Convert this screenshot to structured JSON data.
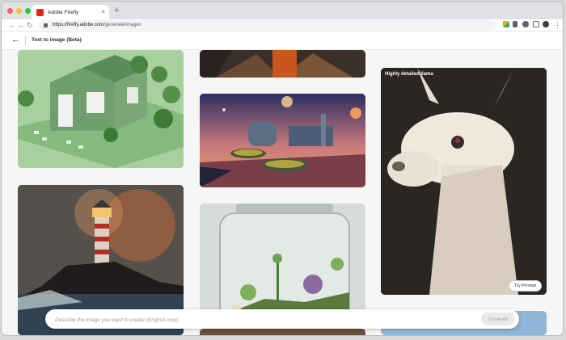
{
  "browser": {
    "tab_title": "Adobe Firefly",
    "new_tab_label": "+",
    "url_host": "https://firefly.adobe.com",
    "url_path": "/generate/images",
    "colors": {
      "close": "#ff5f57",
      "minimize": "#febc2e",
      "maximize": "#28c840",
      "favicon": "#e1251b"
    }
  },
  "app": {
    "title": "Text to image (Beta)"
  },
  "gallery": {
    "cards": [
      {
        "subject": "green cottage",
        "caption": ""
      },
      {
        "subject": "portrait jacket",
        "caption": ""
      },
      {
        "subject": "alien city",
        "caption": ""
      },
      {
        "subject": "lighthouse",
        "caption": ""
      },
      {
        "subject": "terrarium jar",
        "caption": ""
      },
      {
        "subject": "llama",
        "caption": "Highly detailed llama",
        "button": "Try Prompt"
      }
    ]
  },
  "prompt": {
    "placeholder": "Describe the image you want to create (English only)",
    "generate_label": "Generate"
  }
}
